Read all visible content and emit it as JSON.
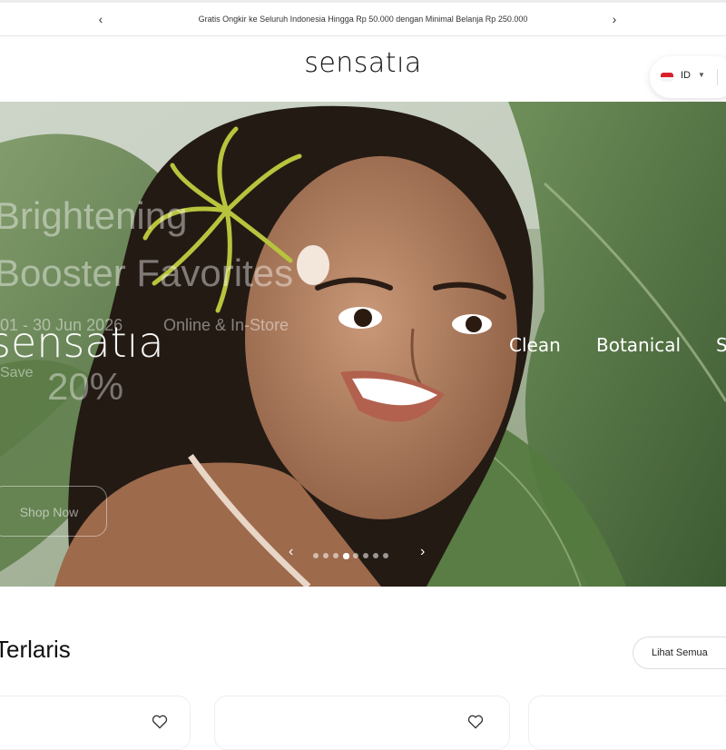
{
  "announcement": {
    "text": "Gratis Ongkir ke Seluruh Indonesia Hingga Rp 50.000 dengan Minimal Belanja Rp 250.000",
    "prev_icon": "chevron-left-icon",
    "next_icon": "chevron-right-icon"
  },
  "header": {
    "logo": "sensatıa",
    "language": {
      "code": "ID",
      "flag_colors": [
        "#d9202a",
        "#f5f5f5"
      ]
    }
  },
  "hero": {
    "banner_faded": {
      "headline_line1": "Brightening",
      "headline_line2": "Booster Favorites",
      "date_range": "01 - 30 Jun 2026",
      "channels": "Online & In-Store",
      "save_label": "Save",
      "discount": "20%",
      "cta": "Shop Now"
    },
    "brand": "sensatıa",
    "taglines": [
      "Clean",
      "Botanical",
      "S"
    ],
    "carousel": {
      "total_slides": 8,
      "active_index": 3
    }
  },
  "bestsellers": {
    "title": "Terlaris",
    "see_all": "Lihat Semua"
  },
  "colors": {
    "accent": "#111111",
    "leaf_green": "#5f7f4a",
    "skin": "#b5825f"
  }
}
